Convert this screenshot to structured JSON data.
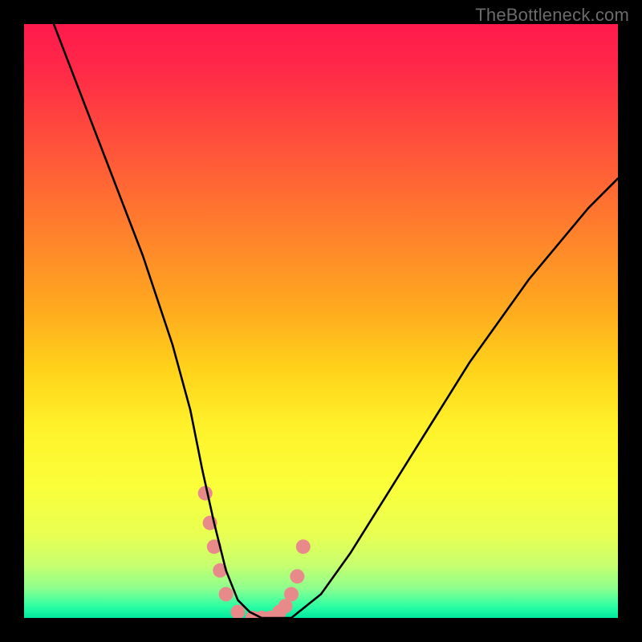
{
  "watermark": "TheBottleneck.com",
  "chart_data": {
    "type": "line",
    "title": "",
    "xlabel": "",
    "ylabel": "",
    "xlim": [
      0,
      100
    ],
    "ylim": [
      0,
      100
    ],
    "grid": false,
    "legend": false,
    "series": [
      {
        "name": "curve",
        "color": "#000000",
        "x": [
          5,
          10,
          15,
          20,
          25,
          28,
          30,
          32,
          34,
          36,
          38,
          40,
          45,
          50,
          55,
          60,
          65,
          70,
          75,
          80,
          85,
          90,
          95,
          100
        ],
        "y": [
          100,
          87,
          74,
          61,
          46,
          35,
          25,
          16,
          8,
          3,
          1,
          0,
          0,
          4,
          11,
          19,
          27,
          35,
          43,
          50,
          57,
          63,
          69,
          74
        ]
      }
    ],
    "markers": [
      {
        "name": "scatter-points",
        "color": "#e98a8a",
        "x": [
          30.5,
          31.3,
          32.0,
          33.0,
          34.0,
          36.0,
          38.5,
          40.0,
          41.5,
          43.0,
          44.0,
          45.0,
          46.0,
          47.0
        ],
        "y": [
          21,
          16,
          12,
          8,
          4,
          1,
          0,
          0,
          0,
          1,
          2,
          4,
          7,
          12
        ]
      }
    ]
  }
}
